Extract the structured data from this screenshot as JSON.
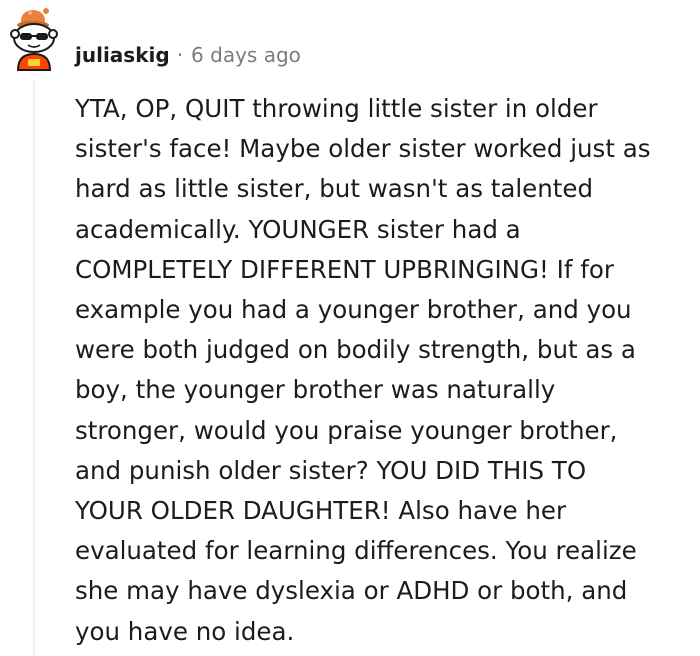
{
  "comment": {
    "author": "juliaskig",
    "separator": "·",
    "timestamp": "6 days ago",
    "body_text": "YTA, OP, QUIT throwing little sister in older\nsister's face! Maybe older sister worked just as\nhard as little sister, but wasn't as talented\nacademically. YOUNGER sister had a\nCOMPLETELY DIFFERENT UPBRINGING! If for\nexample you had a younger brother, and you\nwere both judged on bodily strength, but as a\nboy, the younger brother was naturally\nstronger, would you praise younger brother,\nand punish older sister? YOU DID THIS TO\nYOUR OLDER DAUGHTER! Also have her\nevaluated for learning differences. You realize\nshe may have dyslexia or ADHD or both, and\nyou have no idea.",
    "avatar_icon": "snoo-avatar-icon"
  },
  "colors": {
    "avatar_hat": "#e8823a",
    "avatar_shirt": "#ff4500",
    "thread_line": "#edeff1",
    "meta_gray": "#7c7c7c"
  }
}
